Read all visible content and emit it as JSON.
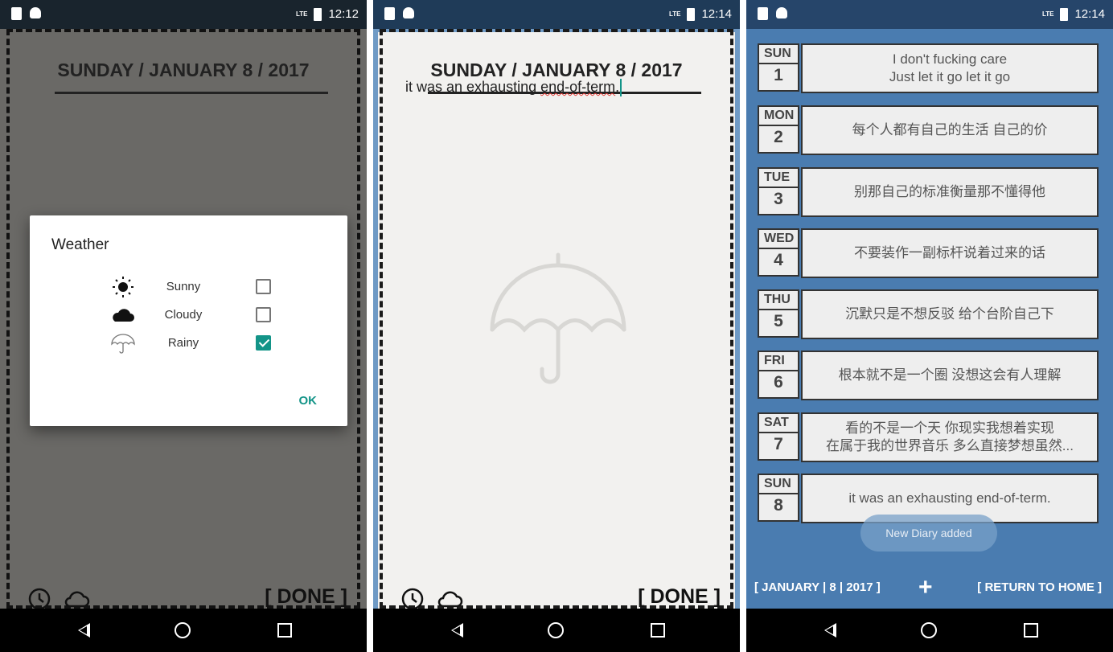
{
  "screens": [
    {
      "status": {
        "time": "12:12",
        "network": "LTE"
      },
      "header": {
        "date_title": "SUNDAY / JANUARY 8 / 2017"
      },
      "dialog": {
        "title": "Weather",
        "options": [
          {
            "label": "Sunny",
            "icon": "sun-icon",
            "checked": false
          },
          {
            "label": "Cloudy",
            "icon": "cloud-icon",
            "checked": false
          },
          {
            "label": "Rainy",
            "icon": "umbrella-icon",
            "checked": true
          }
        ],
        "ok_label": "OK"
      },
      "footer": {
        "done_label": "[ DONE ]"
      }
    },
    {
      "status": {
        "time": "12:14",
        "network": "LTE"
      },
      "header": {
        "date_title": "SUNDAY / JANUARY 8 / 2017"
      },
      "entry": {
        "text_plain": "it was an exhausting ",
        "text_misspelled": "end-of-term",
        "text_tail": "."
      },
      "footer": {
        "done_label": "[ DONE ]"
      }
    },
    {
      "status": {
        "time": "12:14",
        "network": "LTE"
      },
      "diary_items": [
        {
          "day": "SUN",
          "num": "1",
          "lines": [
            "I don't fucking care",
            "Just let it go let it go"
          ]
        },
        {
          "day": "MON",
          "num": "2",
          "lines": [
            "每个人都有自己的生活 自己的价"
          ]
        },
        {
          "day": "TUE",
          "num": "3",
          "lines": [
            "别那自己的标准衡量那不懂得他"
          ]
        },
        {
          "day": "WED",
          "num": "4",
          "lines": [
            "不要装作一副标杆说着过来的话"
          ]
        },
        {
          "day": "THU",
          "num": "5",
          "lines": [
            "沉默只是不想反驳 给个台阶自己下"
          ]
        },
        {
          "day": "FRI",
          "num": "6",
          "lines": [
            "根本就不是一个圈 没想这会有人理解"
          ]
        },
        {
          "day": "SAT",
          "num": "7",
          "lines": [
            "看的不是一个天 你现实我想着实现",
            "在属于我的世界音乐 多么直接梦想虽然..."
          ]
        },
        {
          "day": "SUN",
          "num": "8",
          "lines": [
            "it was an exhausting end-of-term."
          ]
        }
      ],
      "toast": "New Diary added",
      "bottom": {
        "date_label": "[ JANUARY | 8 | 2017 ]",
        "add_label": "+",
        "home_label": "[ RETURN TO HOME ]"
      }
    }
  ],
  "colors": {
    "accent": "#139488",
    "list_bg": "#4a7cb0",
    "card_bg": "#eeeeee"
  }
}
